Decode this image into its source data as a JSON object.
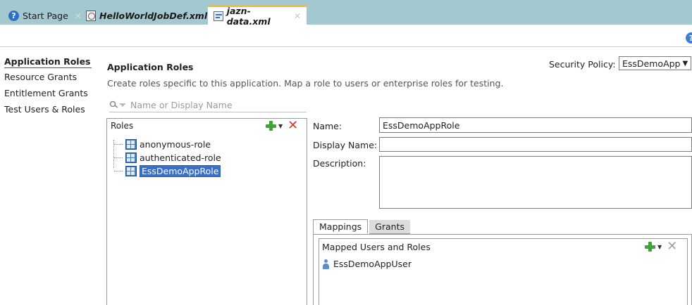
{
  "tabs": [
    {
      "label": "Start Page",
      "icon": "help-circle-icon"
    },
    {
      "label": "HelloWorldJobDef.xml",
      "icon": "job-definition-icon"
    },
    {
      "label": "jazn-data.xml",
      "icon": "policy-file-icon",
      "active": true
    }
  ],
  "help": {
    "glyph": "?"
  },
  "nav": {
    "items": [
      {
        "label": "Application Roles",
        "selected": true
      },
      {
        "label": "Resource Grants"
      },
      {
        "label": "Entitlement Grants"
      },
      {
        "label": "Test Users & Roles"
      }
    ]
  },
  "page": {
    "heading": "Application Roles",
    "description": "Create roles specific to this application. Map a role to users or enterprise roles for testing."
  },
  "security_policy": {
    "label": "Security Policy:",
    "value": "EssDemoApp"
  },
  "search": {
    "placeholder": "Name or Display Name"
  },
  "roles": {
    "header": "Roles",
    "items": [
      {
        "label": "anonymous-role"
      },
      {
        "label": "authenticated-role"
      },
      {
        "label": "EssDemoAppRole",
        "selected": true
      }
    ]
  },
  "form": {
    "name_label": "Name:",
    "name_value": "EssDemoAppRole",
    "display_name_label": "Display Name:",
    "display_name_value": "",
    "description_label": "Description:",
    "description_value": ""
  },
  "subtabs": [
    {
      "label": "Mappings",
      "active": true
    },
    {
      "label": "Grants"
    }
  ],
  "mappings": {
    "header": "Mapped Users and Roles",
    "items": [
      {
        "label": "EssDemoAppUser"
      }
    ]
  },
  "colors": {
    "tabbar": "#a3c8cf",
    "active_tab_accent": "#f2b733",
    "selection": "#3a6fc4"
  }
}
